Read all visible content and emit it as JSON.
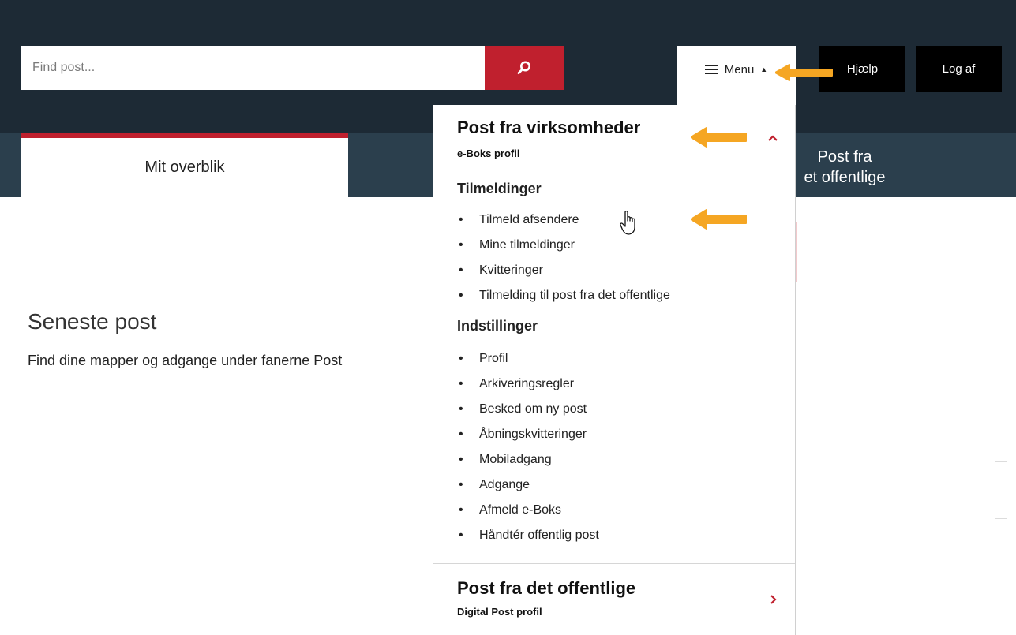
{
  "header": {
    "search_placeholder": "Find post...",
    "menu_label": "Menu",
    "menu_caret": "▲",
    "help_label": "Hjælp",
    "logout_label": "Log af"
  },
  "tabs": {
    "active": "Mit overblik",
    "right_line1": "Post fra",
    "right_line2": "et offentlige"
  },
  "main": {
    "title": "Seneste post",
    "description": "Find dine mapper og adgange under fanerne Post"
  },
  "menu": {
    "section1": {
      "title": "Post fra virksomheder",
      "subtitle": "e-Boks profil",
      "groups": [
        {
          "title": "Tilmeldinger",
          "items": [
            "Tilmeld afsendere",
            "Mine tilmeldinger",
            "Kvitteringer",
            "Tilmelding til post fra det offentlige"
          ]
        },
        {
          "title": "Indstillinger",
          "items": [
            "Profil",
            "Arkiveringsregler",
            "Besked om ny post",
            "Åbningskvitteringer",
            "Mobiladgang",
            "Adgange",
            "Afmeld e-Boks",
            "Håndtér offentlig post"
          ]
        }
      ]
    },
    "section2": {
      "title": "Post fra det offentlige",
      "subtitle": "Digital Post profil"
    }
  },
  "colors": {
    "header_bg": "#1d2a35",
    "tabbar_bg": "#2b3f4d",
    "accent_red": "#c0202e",
    "annotation_arrow": "#f5a623"
  },
  "icons": [
    "search-icon",
    "hamburger-icon",
    "chevron-up-icon",
    "chevron-right-icon",
    "hand-cursor-icon",
    "annotation-arrow-icon"
  ]
}
